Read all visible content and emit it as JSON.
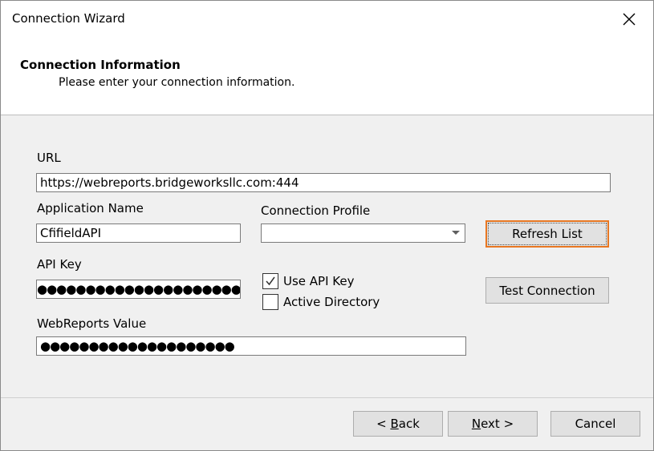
{
  "window": {
    "title": "Connection Wizard"
  },
  "header": {
    "title": "Connection Information",
    "subtitle": "Please enter your connection information."
  },
  "form": {
    "url_label": "URL",
    "url_value": "https://webreports.bridgeworksllc.com:444",
    "app_name_label": "Application Name",
    "app_name_value": "CfifieldAPI",
    "profile_label": "Connection Profile",
    "profile_value": "",
    "api_key_label": "API Key",
    "api_key_mask": "●●●●●●●●●●●●●●●●●●●●●●●●●●●●●",
    "webreports_label": "WebReports Value",
    "webreports_mask": "●●●●●●●●●●●●●●●●●●●●",
    "use_api_key_label": "Use API Key",
    "use_api_key_checked": true,
    "active_directory_label": "Active Directory",
    "active_directory_checked": false
  },
  "buttons": {
    "refresh": "Refresh List",
    "test": "Test Connection",
    "back_accel": "B",
    "back_rest": "ack",
    "back_prefix": "< ",
    "next_accel": "N",
    "next_rest": "ext >",
    "cancel": "Cancel"
  }
}
